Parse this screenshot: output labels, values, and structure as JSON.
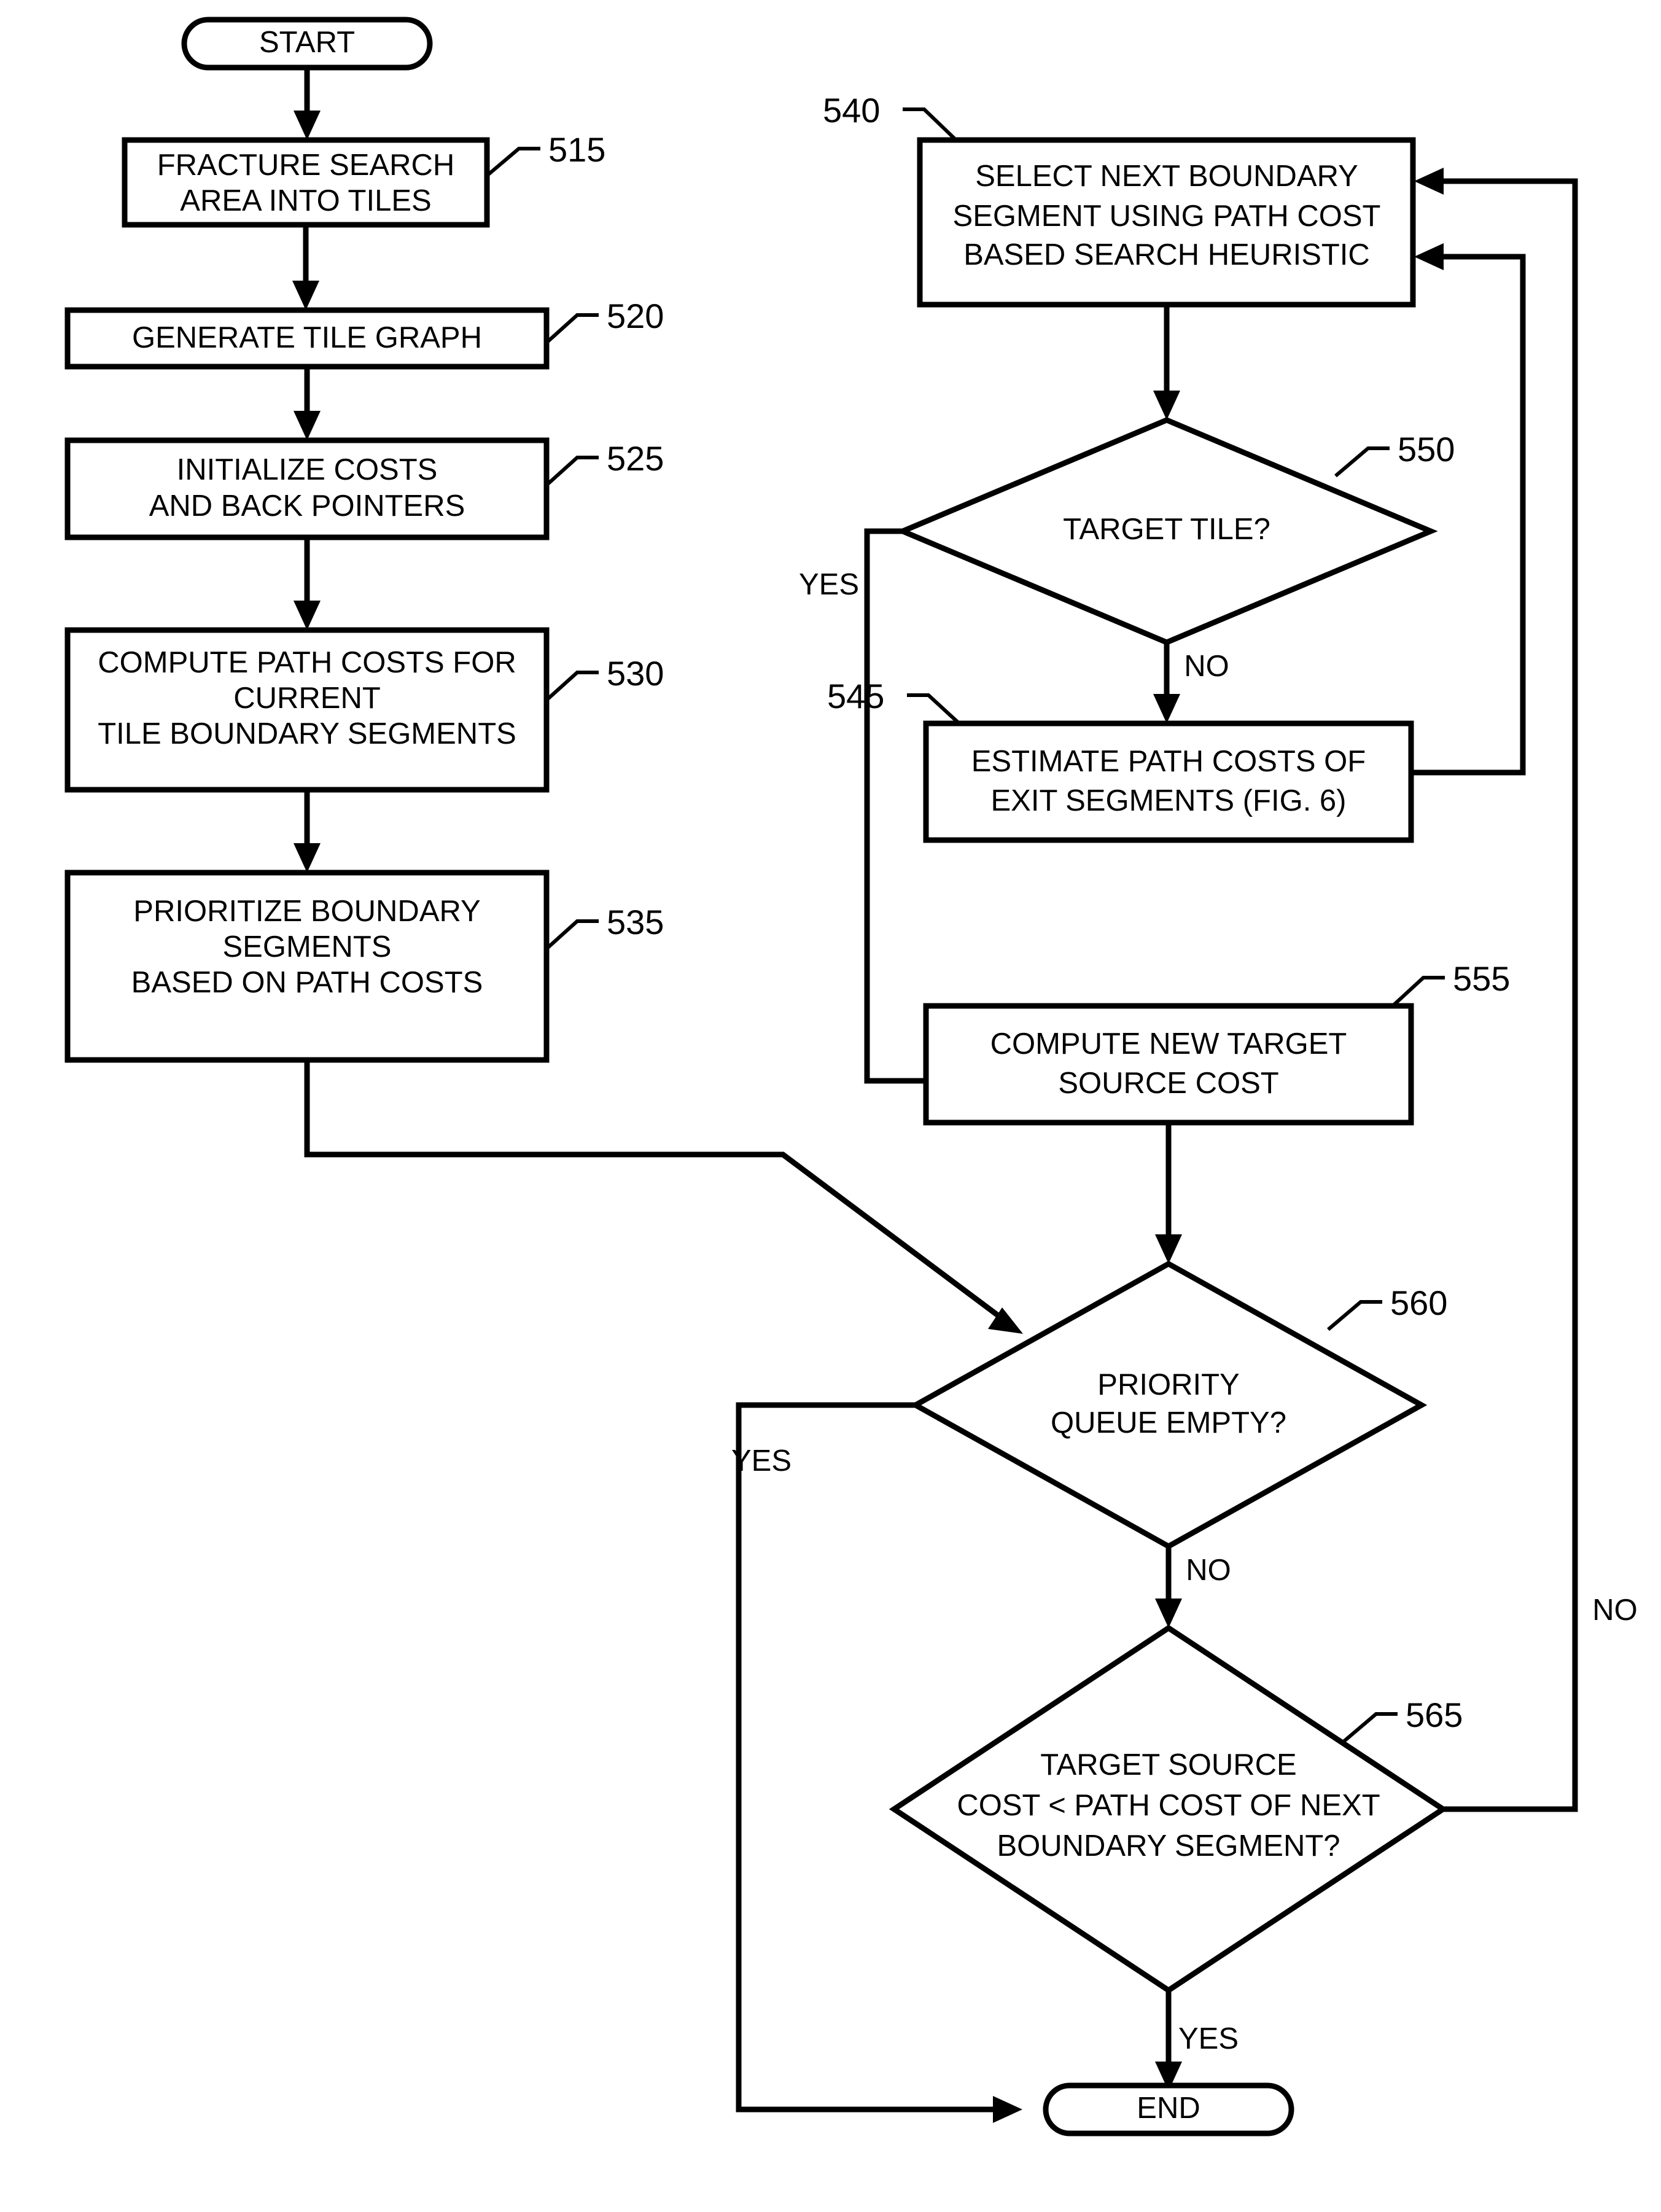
{
  "figure": {
    "type": "flowchart",
    "orientation": "two-column",
    "background_color": "#ffffff",
    "line_color": "#000000"
  },
  "nodes": {
    "start": {
      "shape": "terminator",
      "label": "START"
    },
    "n515": {
      "shape": "process",
      "ref": "515",
      "line1": "FRACTURE SEARCH",
      "line2": "AREA INTO TILES"
    },
    "n520": {
      "shape": "process",
      "ref": "520",
      "line1": "GENERATE TILE GRAPH"
    },
    "n525": {
      "shape": "process",
      "ref": "525",
      "line1": "INITIALIZE COSTS",
      "line2": "AND BACK POINTERS"
    },
    "n530": {
      "shape": "process",
      "ref": "530",
      "line1": "COMPUTE PATH COSTS FOR",
      "line2": "CURRENT",
      "line3": "TILE BOUNDARY SEGMENTS"
    },
    "n535": {
      "shape": "process",
      "ref": "535",
      "line1": "PRIORITIZE BOUNDARY",
      "line2": "SEGMENTS",
      "line3": "BASED ON PATH COSTS"
    },
    "n540": {
      "shape": "process",
      "ref": "540",
      "line1": "SELECT NEXT BOUNDARY",
      "line2": "SEGMENT USING PATH COST",
      "line3": "BASED SEARCH HEURISTIC"
    },
    "n550": {
      "shape": "decision",
      "ref": "550",
      "line1": "TARGET TILE?"
    },
    "n545": {
      "shape": "process",
      "ref": "545",
      "line1": "ESTIMATE PATH COSTS OF",
      "line2": "EXIT SEGMENTS (FIG. 6)"
    },
    "n555": {
      "shape": "process",
      "ref": "555",
      "line1": "COMPUTE NEW TARGET",
      "line2": "SOURCE COST"
    },
    "n560": {
      "shape": "decision",
      "ref": "560",
      "line1": "PRIORITY",
      "line2": "QUEUE EMPTY?"
    },
    "n565": {
      "shape": "decision",
      "ref": "565",
      "line1": "TARGET SOURCE",
      "line2": "COST < PATH COST OF NEXT",
      "line3": "BOUNDARY SEGMENT?"
    },
    "end": {
      "shape": "terminator",
      "label": "END"
    }
  },
  "branch_labels": {
    "d550_yes": "YES",
    "d550_no": "NO",
    "d560_yes": "YES",
    "d560_no": "NO",
    "d565_yes": "YES",
    "d565_no": "NO"
  }
}
